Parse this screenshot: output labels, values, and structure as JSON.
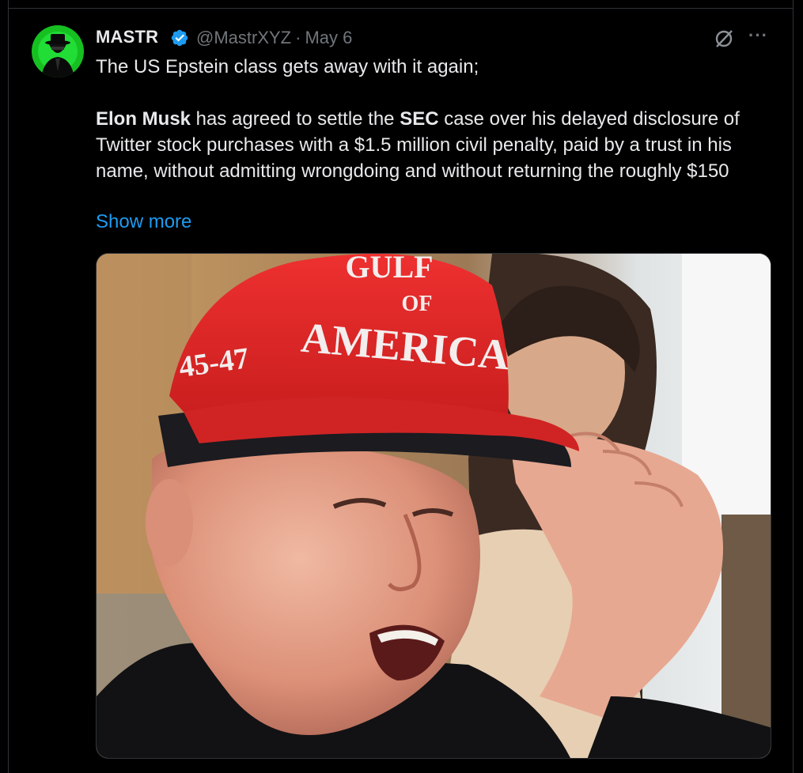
{
  "post": {
    "author_name": "MASTR",
    "author_handle": "@MastrXYZ",
    "separator": "·",
    "date": "May 6",
    "text_line1": "The US Epstein class gets away with it again;",
    "text_bold1": "Elon Musk",
    "text_part1": " has agreed to settle the ",
    "text_bold2": "SEC",
    "text_part2": " case over his delayed disclosure of Twitter stock purchases with a $1.5 million civil penalty, paid by a trust in his name, without admitting wrongdoing and without returning the roughly $150",
    "show_more": "Show more",
    "icons": {
      "verified": "verified-badge-icon",
      "grok": "grok-icon",
      "more": "more-options-icon"
    },
    "media": {
      "hat_text_line1": "GULF",
      "hat_text_line2": "OF",
      "hat_text_line3": "AMERICA",
      "hat_side_text": "45-47"
    }
  },
  "colors": {
    "background": "#000000",
    "text": "#e7e9ea",
    "secondary": "#71767b",
    "link": "#1d9bf0",
    "verified": "#1d9bf0"
  }
}
